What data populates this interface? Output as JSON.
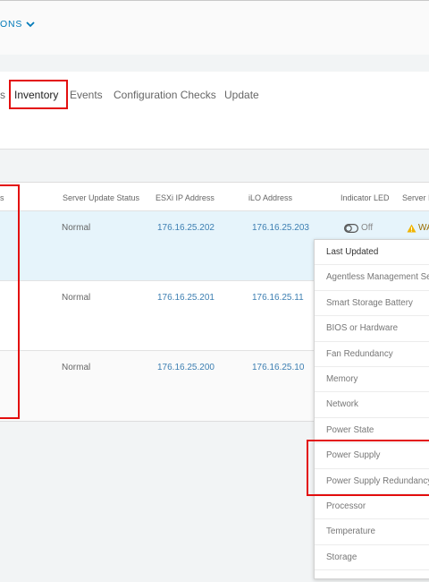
{
  "header": {
    "actions_label": "ONS"
  },
  "tabs": [
    {
      "label": "s"
    },
    {
      "label": "Inventory"
    },
    {
      "label": "Events"
    },
    {
      "label": "Configuration Checks"
    },
    {
      "label": "Update"
    }
  ],
  "table": {
    "columns": {
      "status_partial": "s",
      "server_update_status": "Server Update Status",
      "esxi_ip": "ESXi IP Address",
      "ilo_address": "iLO Address",
      "indicator_led": "Indicator LED",
      "server_partial": "Server I"
    },
    "rows": [
      {
        "update_status": "Normal",
        "esxi_ip": "176.16.25.202",
        "ilo": "176.16.25.203",
        "led": "Off",
        "server_status": "WA"
      },
      {
        "update_status": "Normal",
        "esxi_ip": "176.16.25.201",
        "ilo": "176.16.25.11"
      },
      {
        "update_status": "Normal",
        "esxi_ip": "176.16.25.200",
        "ilo": "176.16.25.10"
      }
    ]
  },
  "dropdown": {
    "items": [
      "Last Updated",
      "Agentless Management Se",
      "Smart Storage Battery",
      "BIOS or Hardware",
      "Fan Redundancy",
      "Memory",
      "Network",
      "Power State",
      "Power Supply",
      "Power Supply Redundancy",
      "Processor",
      "Temperature",
      "Storage"
    ]
  },
  "colors": {
    "accent": "#0079b8",
    "highlight": "#e30e0e",
    "selected_row": "#e6f4fb",
    "warning": "#f0b400"
  }
}
